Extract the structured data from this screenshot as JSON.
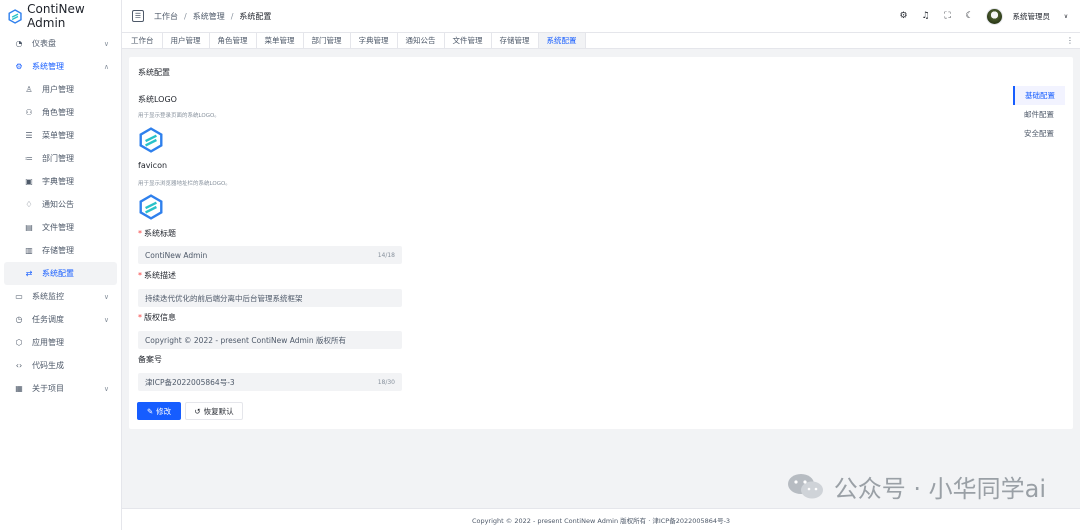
{
  "app": {
    "name": "ContiNew Admin"
  },
  "sidebar": {
    "items": [
      {
        "label": "仪表盘",
        "icon": "dashboard-icon",
        "chevron": "∨"
      },
      {
        "label": "系统管理",
        "icon": "settings-icon",
        "chevron": "∧"
      },
      {
        "label": "用户管理",
        "icon": "user-icon"
      },
      {
        "label": "角色管理",
        "icon": "users-icon"
      },
      {
        "label": "菜单管理",
        "icon": "menu-icon"
      },
      {
        "label": "部门管理",
        "icon": "dept-icon"
      },
      {
        "label": "字典管理",
        "icon": "dict-icon"
      },
      {
        "label": "通知公告",
        "icon": "bell-icon"
      },
      {
        "label": "文件管理",
        "icon": "file-icon"
      },
      {
        "label": "存储管理",
        "icon": "storage-icon"
      },
      {
        "label": "系统配置",
        "icon": "config-icon"
      },
      {
        "label": "系统监控",
        "icon": "monitor-icon",
        "chevron": "∨"
      },
      {
        "label": "任务调度",
        "icon": "clock-icon",
        "chevron": "∨"
      },
      {
        "label": "应用管理",
        "icon": "app-icon"
      },
      {
        "label": "代码生成",
        "icon": "code-icon"
      },
      {
        "label": "关于项目",
        "icon": "grid-icon",
        "chevron": "∨"
      }
    ]
  },
  "header": {
    "breadcrumb": [
      "工作台",
      "系统管理",
      "系统配置"
    ],
    "separator": "/",
    "user_name": "系统管理员"
  },
  "tabs": [
    "工作台",
    "用户管理",
    "角色管理",
    "菜单管理",
    "部门管理",
    "字典管理",
    "通知公告",
    "文件管理",
    "存储管理",
    "系统配置"
  ],
  "main": {
    "title": "系统配置",
    "logo_label": "系统LOGO",
    "logo_hint": "用于显示登录页面的系统LOGO。",
    "favicon_label": "favicon",
    "favicon_hint": "用于显示浏览器地址栏的系统LOGO。",
    "title_label": "系统标题",
    "title_value": "ContiNew Admin",
    "title_count": "14/18",
    "desc_label": "系统描述",
    "desc_value": "持续迭代优化的前后端分离中后台管理系统框架",
    "copyright_label": "版权信息",
    "copyright_value": "Copyright © 2022 - present ContiNew Admin 版权所有",
    "beian_label": "备案号",
    "beian_value": "津ICP备2022005864号-3",
    "beian_count": "18/30",
    "edit_button": "修改",
    "reset_button": "恢复默认",
    "required_mark": "*"
  },
  "anchor": [
    "基础配置",
    "邮件配置",
    "安全配置"
  ],
  "footer": "Copyright © 2022 - present ContiNew Admin 版权所有 · 津ICP备2022005864号-3",
  "watermark": "公众号 · 小华同学ai",
  "colors": {
    "primary": "#165dff",
    "danger": "#f53f3f",
    "bg": "#f2f3f5"
  }
}
